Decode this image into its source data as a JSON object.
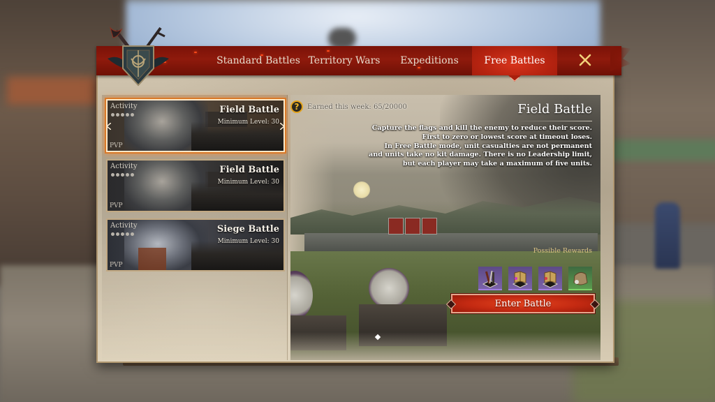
{
  "header": {
    "emblem": "crest-shield-icon",
    "tabs": [
      {
        "label": "Standard Battles",
        "active": false
      },
      {
        "label": "Territory Wars",
        "active": false
      },
      {
        "label": "Expeditions",
        "active": false
      },
      {
        "label": "Free Battles",
        "active": true
      }
    ],
    "close_icon": "close-x-icon"
  },
  "battle_list": [
    {
      "tag": "Activity",
      "activity_dots": 5,
      "title": "Field Battle",
      "min_level": "Minimum Level: 30",
      "type": "PVP",
      "selected": true
    },
    {
      "tag": "Activity",
      "activity_dots": 5,
      "title": "Field Battle",
      "min_level": "Minimum Level: 30",
      "type": "PVP",
      "selected": false
    },
    {
      "tag": "Activity",
      "activity_dots": 5,
      "title": "Siege Battle",
      "min_level": "Minimum Level: 30",
      "type": "PVP",
      "selected": false
    }
  ],
  "detail": {
    "earned_text": "Earned this week: 65/20000",
    "help_icon": "question-icon",
    "title": "Field Battle",
    "description": [
      "Capture the flags and kill the enemy to reduce their score. First to zero or lowest score at timeout loses.",
      "In Free Battle mode, unit casualties are not permanent and units take no kit damage. There is no Leadership limit, but each player may take a maximum of five units."
    ],
    "rewards_label": "Possible Rewards",
    "rewards": [
      {
        "icon": "weapons-bundle-icon",
        "rarity": "epic"
      },
      {
        "icon": "scroll-book-icon",
        "rarity": "epic"
      },
      {
        "icon": "scroll-book-icon",
        "rarity": "epic"
      },
      {
        "icon": "loot-sack-icon",
        "rarity": "uncommon"
      }
    ],
    "enter_button": "Enter Battle"
  },
  "colors": {
    "header_red": "#8f1a0c",
    "active_tab": "#c42a12",
    "button_red": "#d2331a",
    "epic_purple": "#6e58a0",
    "uncommon_green": "#4e8a48",
    "gold_text": "#d9c182",
    "help_icon_gold": "#e3a21a"
  }
}
